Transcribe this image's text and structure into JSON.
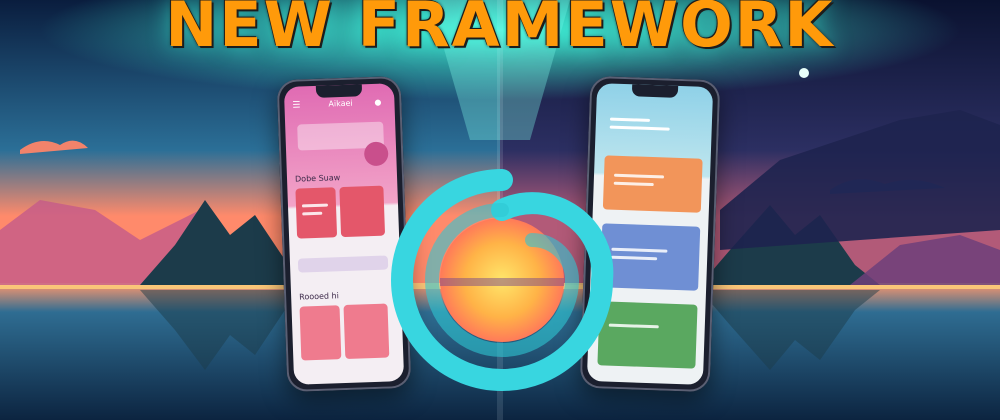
{
  "headline": {
    "text": "NEW FRAMEWORK",
    "color": "#ff9a0a"
  },
  "left_phone": {
    "app_title": "Aikaei",
    "section_1": "Dobe Suaw",
    "section_2": "Roooed hi"
  },
  "right_phone": {
    "app_title": "",
    "section_1": ""
  },
  "logo": {
    "icon": "spiral-logo-icon",
    "color": "#38d6e0"
  },
  "colors": {
    "sky_top": "#0d1a3a",
    "sky_mid": "#2a5f8f",
    "glow": "#3ef2d6",
    "water": "#1a4a6a",
    "mountain": "#1c3b4a",
    "accent_pink": "#e06bb3",
    "accent_orange": "#ff9a0a"
  }
}
